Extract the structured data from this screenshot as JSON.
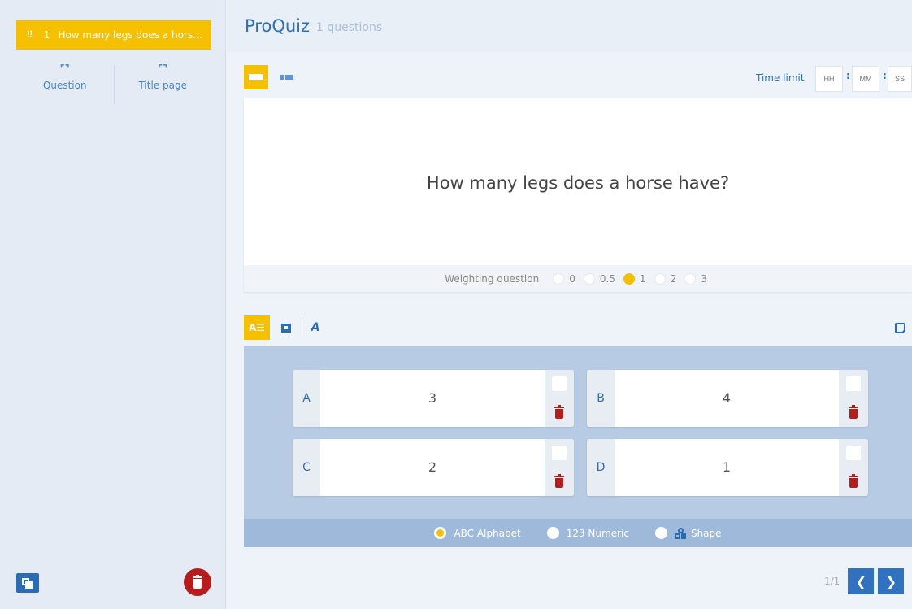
{
  "sidebar": {
    "question_item": {
      "number": "1",
      "text": "How many legs does a hors..."
    },
    "add_question_label": "Question",
    "add_title_page_label": "Title page"
  },
  "header": {
    "title": "ProQuiz",
    "subtitle": "1 questions"
  },
  "time_limit": {
    "label": "Time limit",
    "hh_placeholder": "HH",
    "mm_placeholder": "MM",
    "ss_placeholder": "SS",
    "separator": ":"
  },
  "question": {
    "text": "How many legs does a horse have?"
  },
  "weighting": {
    "label": "Weighting question",
    "options": [
      "0",
      "0.5",
      "1",
      "2",
      "3"
    ],
    "selected": "1"
  },
  "answers": [
    {
      "letter": "A",
      "value": "3"
    },
    {
      "letter": "B",
      "value": "4"
    },
    {
      "letter": "C",
      "value": "2"
    },
    {
      "letter": "D",
      "value": "1"
    }
  ],
  "label_type": {
    "options": [
      "ABC Alphabet",
      "123 Numeric",
      "Shape"
    ],
    "selected": "ABC Alphabet"
  },
  "pagination": {
    "text": "1/1"
  },
  "colors": {
    "accent": "#f5c000",
    "primary": "#2f6fb6",
    "danger": "#b71c1c"
  }
}
